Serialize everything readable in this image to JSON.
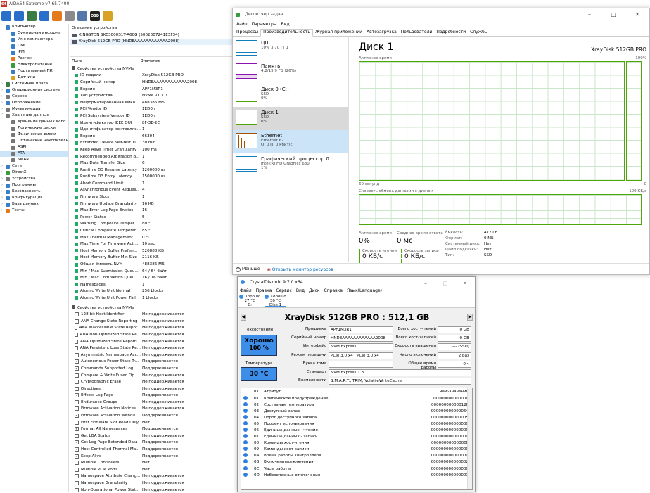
{
  "aida": {
    "title": "AIDA64 Extreme v7.65.7400",
    "logo": "64",
    "toolbar": [
      {
        "icon": "back-arrow-icon",
        "color": "#2a6fc9"
      },
      {
        "icon": "forward-arrow-icon",
        "color": "#2a6fc9"
      },
      {
        "icon": "board-icon",
        "color": "#3a7d44"
      },
      {
        "icon": "network-icon",
        "color": "#2a6fc9"
      },
      {
        "icon": "flame-icon",
        "color": "#e6781e"
      },
      {
        "icon": "tools-icon",
        "color": "#8a8a8a"
      },
      {
        "icon": "user-icon",
        "color": "#5577aa"
      },
      {
        "icon": "osd-icon",
        "color": "#222222",
        "label": "OSD"
      },
      {
        "icon": "gauge-icon",
        "color": "#d8a325"
      }
    ],
    "tree": [
      {
        "label": "Компьютер",
        "indent": 0,
        "exp": "v",
        "color": "#3a7ec8"
      },
      {
        "label": "Суммарная информа",
        "indent": 1,
        "color": "#3a7ec8"
      },
      {
        "label": "Имя компьютера",
        "indent": 1,
        "color": "#3a7ec8"
      },
      {
        "label": "DMI",
        "indent": 1,
        "color": "#3a7ec8"
      },
      {
        "label": "IPMI",
        "indent": 1,
        "color": "#3a7ec8"
      },
      {
        "label": "Разгон",
        "indent": 1,
        "color": "#e6781e"
      },
      {
        "label": "Электропитание",
        "indent": 1,
        "color": "#3a9b3a"
      },
      {
        "label": "Портативный ПК",
        "indent": 1,
        "color": "#3a7ec8"
      },
      {
        "label": "Датчики",
        "indent": 1,
        "color": "#d8a325"
      },
      {
        "label": "Системная плата",
        "indent": 0,
        "exp": ">",
        "color": "#3a7d44"
      },
      {
        "label": "Операционная система",
        "indent": 0,
        "exp": ">",
        "color": "#3a7ec8"
      },
      {
        "label": "Сервер",
        "indent": 0,
        "exp": ">",
        "color": "#777777"
      },
      {
        "label": "Отображение",
        "indent": 0,
        "exp": ">",
        "color": "#3a7ec8"
      },
      {
        "label": "Мультимедиа",
        "indent": 0,
        "exp": ">",
        "color": "#777777"
      },
      {
        "label": "Хранение данных",
        "indent": 0,
        "exp": "v",
        "color": "#777777"
      },
      {
        "label": "Хранение данных Wind",
        "indent": 1,
        "color": "#777777"
      },
      {
        "label": "Логические диски",
        "indent": 1,
        "color": "#777777"
      },
      {
        "label": "Физические диски",
        "indent": 1,
        "color": "#777777"
      },
      {
        "label": "Оптические накопитель",
        "indent": 1,
        "color": "#777777"
      },
      {
        "label": "ASPI",
        "indent": 1,
        "color": "#777777"
      },
      {
        "label": "ATA",
        "indent": 1,
        "color": "#777777",
        "sel": true
      },
      {
        "label": "SMART",
        "indent": 1,
        "color": "#777777"
      },
      {
        "label": "Сеть",
        "indent": 0,
        "exp": ">",
        "color": "#3a7ec8"
      },
      {
        "label": "DirectX",
        "indent": 0,
        "exp": ">",
        "color": "#3a9b3a"
      },
      {
        "label": "Устройства",
        "indent": 0,
        "exp": ">",
        "color": "#777777"
      },
      {
        "label": "Программы",
        "indent": 0,
        "exp": ">",
        "color": "#3a7ec8"
      },
      {
        "label": "Безопасность",
        "indent": 0,
        "exp": ">",
        "color": "#3a7ec8"
      },
      {
        "label": "Конфигурация",
        "indent": 0,
        "exp": ">",
        "color": "#3a7ec8"
      },
      {
        "label": "База данных",
        "indent": 0,
        "exp": ">",
        "color": "#3a7ec8"
      },
      {
        "label": "Тесты",
        "indent": 0,
        "exp": ">",
        "color": "#e6781e"
      }
    ],
    "devices_header": "Описание устройства",
    "devices": [
      {
        "label": "KINGSTON SKC3000S1T-A60G (50026B7241E3F34)",
        "sel": false
      },
      {
        "label": "XrayDisk 512GB PRO (HNDEAAAAAAAAAAAA2008)",
        "sel": true
      }
    ],
    "col_field": "Поле",
    "col_value": "Значение",
    "section1": "Свойства устройства NVMe",
    "props": [
      [
        "ID модели",
        "XrayDisk 512GB PRO"
      ],
      [
        "Серийный номер",
        "HNDEAAAAAAAAAAAA2008"
      ],
      [
        "Версия",
        "APF1M3R1"
      ],
      [
        "Тип устройства",
        "NVMe v1.3.0"
      ],
      [
        "Неформатированная ёмко...",
        "488386 МБ"
      ],
      [
        "PCI Vendor ID",
        "1ED0h"
      ],
      [
        "PCI Subsystem Vendor ID",
        "1ED0h"
      ],
      [
        "Идентификатор IEEE OUI",
        "8F-3E-2C"
      ],
      [
        "Идентификатор контролле...",
        "1"
      ],
      [
        "Версия",
        "66304"
      ],
      [
        "Extended Device Self-test Ti...",
        "30 min"
      ],
      [
        "Keep Alive Timer Granularity",
        "100 ms"
      ],
      [
        "Recommended Arbitration B...",
        "1"
      ],
      [
        "Max Data Transfer Size",
        "6"
      ],
      [
        "Runtime D3 Resume Latency",
        "1200000 us"
      ],
      [
        "Runtime D3 Entry Latency",
        "1500000 us"
      ],
      [
        "Abort Command Limit",
        "1"
      ],
      [
        "Asynchronous Event Reques...",
        "4"
      ],
      [
        "Firmware Slots",
        "1"
      ],
      [
        "Firmware Update Granularity",
        "16 КБ"
      ],
      [
        "Max Error Log Page Entries",
        "16"
      ],
      [
        "Power States",
        "5"
      ],
      [
        "Warning Composite Temper...",
        "80 °C"
      ],
      [
        "Critical Composite Temperat...",
        "85 °C"
      ],
      [
        "Max Thermal Management ...",
        "0 °C"
      ],
      [
        "Max Time For Firmware Acti...",
        "10 sec"
      ],
      [
        "Host Memory Buffer Preferr...",
        "520888 КБ"
      ],
      [
        "Host Memory Buffer Min Size",
        "2116 КБ"
      ],
      [
        "Общая ёмкость NVM",
        "488386 МБ"
      ],
      [
        "Min / Max Submission Queu...",
        "64 / 64 байт"
      ],
      [
        "Min / Max Completion Queu...",
        "16 / 16 байт"
      ],
      [
        "Namespaces",
        "1"
      ],
      [
        "Atomic Write Unit Normal",
        "256 blocks"
      ],
      [
        "Atomic Write Unit Power Fail",
        "1 blocks"
      ]
    ],
    "section2": "Свойства устройства NVMe",
    "features": [
      [
        "128-bit Host Identifier",
        "Не поддерживается",
        false
      ],
      [
        "ANA Change State Reporting",
        "Не поддерживается",
        false
      ],
      [
        "ANA Inaccessible State Repor...",
        "Не поддерживается",
        false
      ],
      [
        "ANA Non-Optimized State Re...",
        "Не поддерживается",
        false
      ],
      [
        "ANA Optimized State Reporti...",
        "Не поддерживается",
        false
      ],
      [
        "ANA Persistent Loss State Re...",
        "Не поддерживается",
        false
      ],
      [
        "Asymmetric Namespace Acc...",
        "Не поддерживается",
        false
      ],
      [
        "Autonomous Power State Tr...",
        "Поддерживается",
        true
      ],
      [
        "Commands Supported Log ...",
        "Поддерживается",
        true
      ],
      [
        "Compare & Write Fused Op...",
        "Не поддерживается",
        false
      ],
      [
        "Cryptographic Erase",
        "Не поддерживается",
        false
      ],
      [
        "Directives",
        "Не поддерживается",
        false
      ],
      [
        "Effects Log Page",
        "Поддерживается",
        true
      ],
      [
        "Endurance Groups",
        "Не поддерживается",
        false
      ],
      [
        "Firmware Activation Notices",
        "Не поддерживается",
        false
      ],
      [
        "Firmware Activation Withou...",
        "Поддерживается",
        true
      ],
      [
        "First Firmware Slot Read Only",
        "Нет",
        false
      ],
      [
        "Format All Namespaces",
        "Поддерживается",
        true
      ],
      [
        "Get LBA Status",
        "Не поддерживается",
        false
      ],
      [
        "Get Log Page Extended Data",
        "Поддерживается",
        true
      ],
      [
        "Host Controlled Thermal Ma...",
        "Поддерживается",
        true
      ],
      [
        "Keep Alive",
        "Поддерживается",
        true
      ],
      [
        "Multiple Controllers",
        "Нет",
        false
      ],
      [
        "Multiple PCIe Ports",
        "Нет",
        false
      ],
      [
        "Namespace Attribute Chang...",
        "Не поддерживается",
        false
      ],
      [
        "Namespace Granularity",
        "Не поддерживается",
        false
      ],
      [
        "Non-Operational Power Stat...",
        "Не поддерживается",
        false
      ]
    ]
  },
  "taskmgr": {
    "title": "Диспетчер задач",
    "menu": [
      "Файл",
      "Параметры",
      "Вид"
    ],
    "tabs": [
      "Процессы",
      "Производительность",
      "Журнал приложений",
      "Автозагрузка",
      "Пользователи",
      "Подробности",
      "Службы"
    ],
    "active_tab": 1,
    "resources": [
      {
        "name": "ЦП",
        "sub1": "10% 3,70 ГГц",
        "sub2": "",
        "color": "#117dbb"
      },
      {
        "name": "Память",
        "sub1": "4,2/15,9 ГБ (26%)",
        "sub2": "",
        "color": "#8b12ae"
      },
      {
        "name": "Диск 0 (C:)",
        "sub1": "SSD",
        "sub2": "0%",
        "color": "#4da60c"
      },
      {
        "name": "Диск 1",
        "sub1": "SSD",
        "sub2": "0%",
        "color": "#4da60c",
        "state": "sel2"
      },
      {
        "name": "Ethernet",
        "sub1": "Ethernet 62",
        "sub2": "О: 0 П: 0 кбит/с",
        "color": "#a74f01",
        "state": "sel"
      },
      {
        "name": "Графический процессор 0",
        "sub1": "Intel(R) HD Graphics 630",
        "sub2": "1%",
        "color": "#117dbb"
      }
    ],
    "disk_title": "Диск 1",
    "disk_model": "XrayDisk 512GB PRO",
    "active_time_label": "Активное время",
    "pct_100": "100%",
    "sec60": "60 секунд",
    "sec60b": "60 секунд",
    "zero": "0",
    "transfer_label": "Скорость обмена данными с диском",
    "kbs100": "100 КБ/с",
    "stats": {
      "active_label": "Активное время",
      "active_value": "0%",
      "resp_label": "Среднее время ответа",
      "resp_value": "0 мс",
      "read_label": "Скорость чтения",
      "read_value": "0 КБ/с",
      "write_label": "Скорость записи",
      "write_value": "0 КБ/с",
      "details": [
        [
          "Ёмкость:",
          "477 ГБ"
        ],
        [
          "Формат:",
          "0 МБ"
        ],
        [
          "Системный диск:",
          "Нет"
        ],
        [
          "Файл подкачки:",
          "Нет"
        ],
        [
          "Тип:",
          "SSD"
        ]
      ]
    },
    "less": "Меньше",
    "open_monitor": "Открыть монитор ресурсов"
  },
  "cdi": {
    "title": "CrystalDiskInfo 9.7.0 x64",
    "menu": [
      "Файл",
      "Правка",
      "Сервис",
      "Вид",
      "Диск",
      "Справка",
      "Язык(Language)"
    ],
    "disks": [
      {
        "status": "Хорошо",
        "temp": "27 °C",
        "letter": "C:"
      },
      {
        "status": "Хорошо",
        "temp": "30 °C",
        "letter": "Disk 1"
      }
    ],
    "model": "XrayDisk 512GB PRO : 512,1 GB",
    "tech_label": "Техсостояние",
    "health_status": "Хорошо",
    "health_pct": "100 %",
    "temp_label": "Температура",
    "temp_value": "30 °C",
    "fields_left": [
      [
        "Прошивка",
        "APF1M3R1"
      ],
      [
        "Серийный номер",
        "HNDEAAAAAAAAAAAA2008"
      ],
      [
        "Интерфейс",
        "NVM Express"
      ],
      [
        "Режим передачи",
        "PCIe 3.0 x4 | PCIe 3.0 x4"
      ],
      [
        "Буква тома",
        ""
      ]
    ],
    "fields_right": [
      [
        "Всего хост-чтений",
        "0 GB"
      ],
      [
        "Всего хост-записей",
        "0 GB"
      ],
      [
        "Скорость вращения",
        "---- (SSD)"
      ],
      [
        "Число включений",
        "2 раз"
      ],
      [
        "Общее время работы",
        "0 ч"
      ]
    ],
    "standard_label": "Стандарт",
    "standard_value": "NVM Express 1.3",
    "features_label": "Возможности",
    "features_value": "S.M.A.R.T., TRIM, VolatileWriteCache",
    "attr_headers": [
      "ID",
      "Атрибут",
      "Raw-значения"
    ],
    "attrs": [
      [
        "01",
        "Критическое предупреждение",
        "00000000000000"
      ],
      [
        "02",
        "Составная температура",
        "00000000000012F"
      ],
      [
        "03",
        "Доступный запас",
        "000000000000064"
      ],
      [
        "04",
        "Порог доступного запаса",
        "000000000000005"
      ],
      [
        "05",
        "Процент использования",
        "000000000000000"
      ],
      [
        "06",
        "Единицы данных - чтение",
        "000000000000000"
      ],
      [
        "07",
        "Единицы данных - запись",
        "000000000000000"
      ],
      [
        "08",
        "Команды хост-чтения",
        "00000000000000F"
      ],
      [
        "09",
        "Команды хост-записи",
        "000000000000000"
      ],
      [
        "0A",
        "Время работы контроллера",
        "000000000000000"
      ],
      [
        "0B",
        "Включения/отключения",
        "000000000000002"
      ],
      [
        "0C",
        "Часы работы",
        "000000000000000"
      ],
      [
        "0D",
        "Небезопасные отключения",
        "000000000000001"
      ]
    ]
  }
}
